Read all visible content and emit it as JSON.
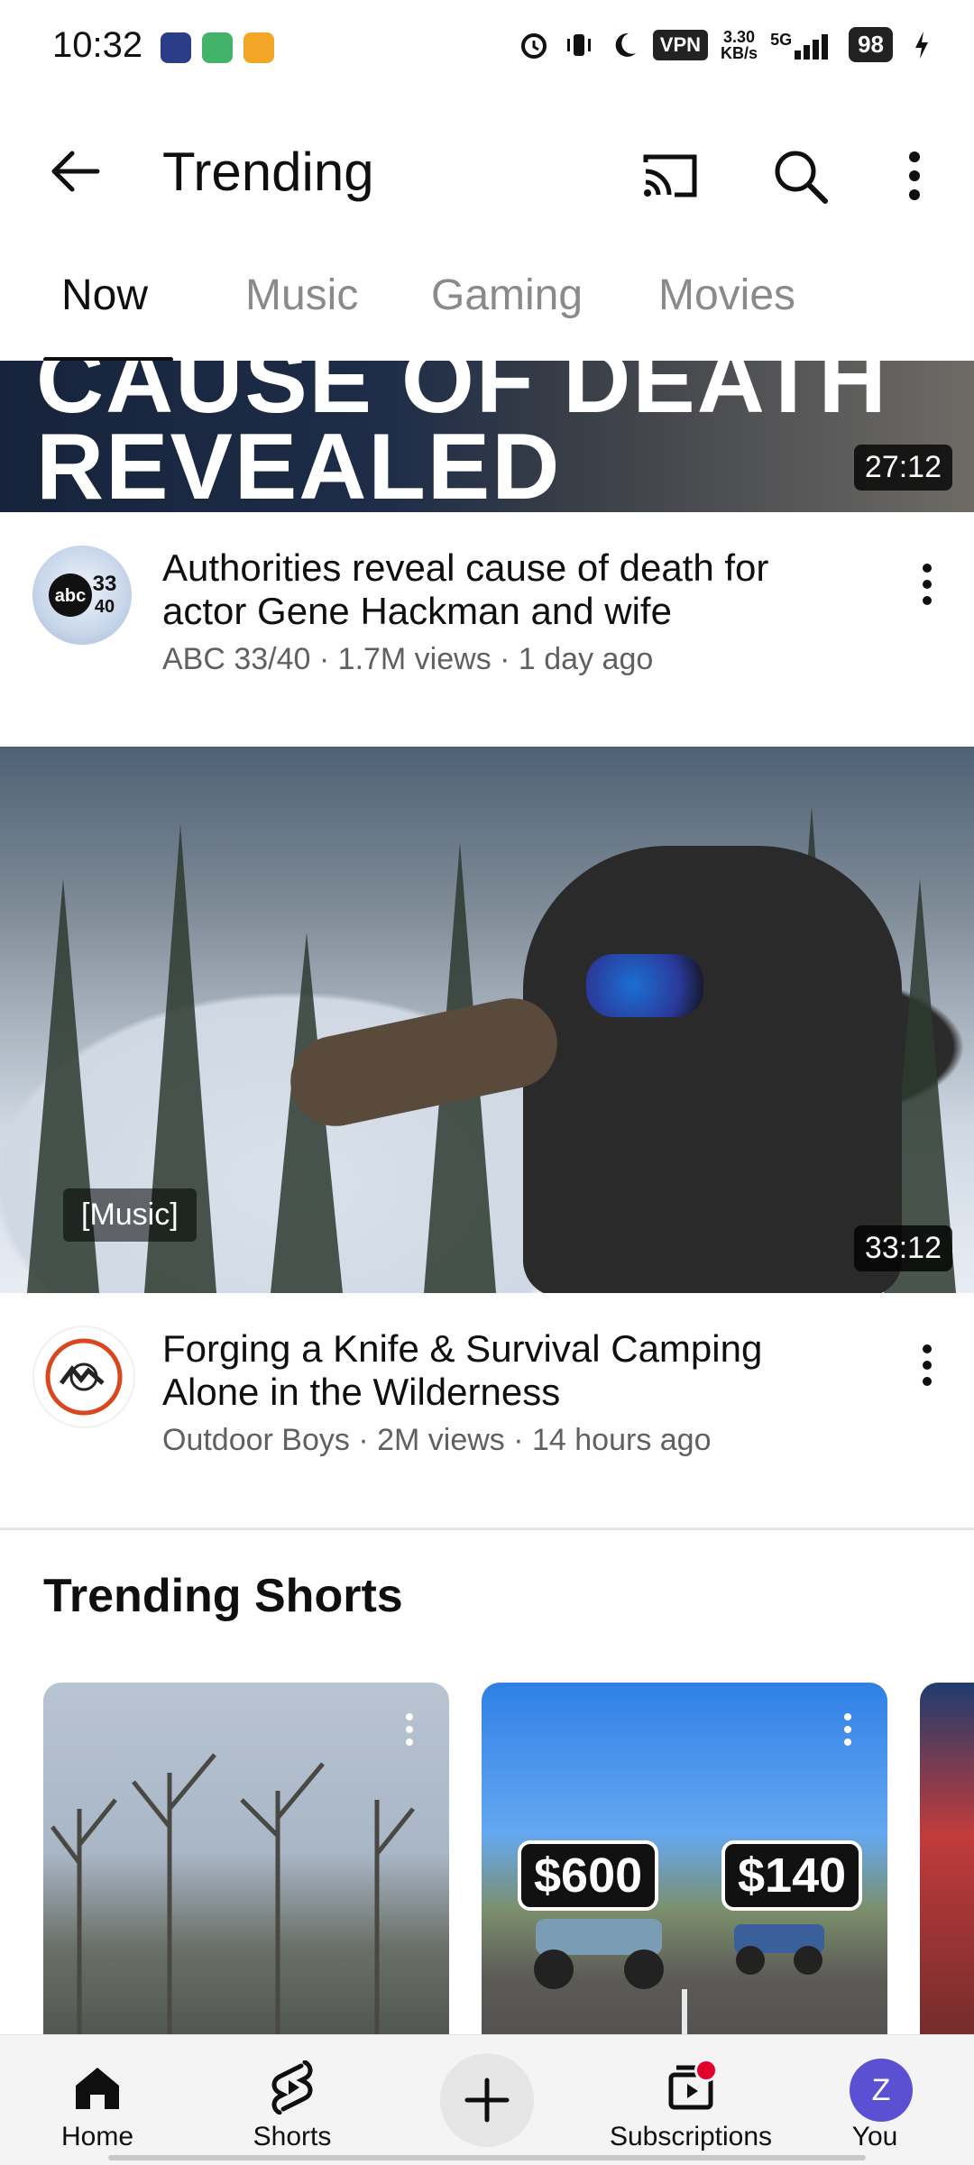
{
  "status_bar": {
    "time": "10:32",
    "vpn": "VPN",
    "speed_top": "3.30",
    "speed_bottom": "KB/s",
    "network": "5G",
    "battery": "98"
  },
  "app_bar": {
    "title": "Trending"
  },
  "tabs": [
    {
      "label": "Now",
      "active": true
    },
    {
      "label": "Music",
      "active": false
    },
    {
      "label": "Gaming",
      "active": false
    },
    {
      "label": "Movies",
      "active": false
    }
  ],
  "videos": [
    {
      "thumbnail_text": "REVEALED",
      "thumbnail_text_top": "CAUSE OF DEATH",
      "duration": "27:12",
      "title": "Authorities reveal cause of death for actor Gene Hackman and wife",
      "channel": "ABC 33/40",
      "views": "1.7M views",
      "age": "1 day ago",
      "meta": "ABC 33/40 · 1.7M views · 1 day ago"
    },
    {
      "caption_chip": "[Music]",
      "duration": "33:12",
      "title": "Forging a Knife & Survival Camping Alone in the Wilderness",
      "channel": "Outdoor Boys",
      "views": "2M views",
      "age": "14 hours ago",
      "meta": "Outdoor Boys · 2M views · 14 hours ago"
    }
  ],
  "shorts_section": {
    "title": "Trending Shorts",
    "items": [
      {
        "price_left": "",
        "price_right": ""
      },
      {
        "price_left": "$600",
        "price_right": "$140"
      },
      {
        "price_left": "",
        "price_right": ""
      }
    ]
  },
  "bottom_nav": {
    "home": "Home",
    "shorts": "Shorts",
    "subscriptions": "Subscriptions",
    "you": "You",
    "you_initial": "Z"
  },
  "colors": {
    "accent_red": "#e1002d",
    "you_avatar": "#5b4fd3"
  }
}
